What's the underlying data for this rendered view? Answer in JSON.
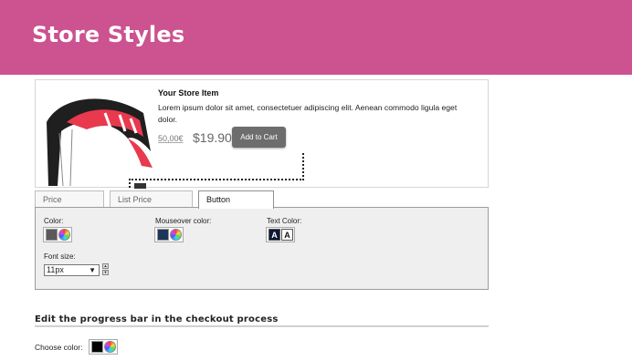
{
  "header": {
    "title": "Store Styles",
    "bg_color": "#cc5290"
  },
  "preview": {
    "image": "kite-product-image",
    "item_title": "Your Store Item",
    "description": "Lorem ipsum dolor sit amet, consectetuer adipiscing elit. Aenean commodo ligula eget dolor.",
    "list_price": "50,00€",
    "sale_price": "$19.90",
    "add_to_cart_label": "Add to Cart",
    "button_color": "#6d6d6d"
  },
  "tabs": [
    {
      "label": "Price",
      "active": false
    },
    {
      "label": "List Price",
      "active": false
    },
    {
      "label": "Button",
      "active": true
    }
  ],
  "button_panel": {
    "color_label": "Color:",
    "color_value": "#5a5a5a",
    "mouseover_label": "Mouseover color:",
    "mouseover_value": "#1e3657",
    "text_color_label": "Text Color:",
    "text_color_options": [
      {
        "glyph": "A",
        "bg": "#0d1a33",
        "fg": "#ffffff",
        "selected": true
      },
      {
        "glyph": "A",
        "bg": "#ffffff",
        "fg": "#111111",
        "selected": false
      }
    ],
    "font_size_label": "Font size:",
    "font_size_value": "11px"
  },
  "progress_bar": {
    "section_title": "Edit the progress bar in the checkout process",
    "choose_color_label": "Choose color:",
    "color_value": "#000000"
  }
}
